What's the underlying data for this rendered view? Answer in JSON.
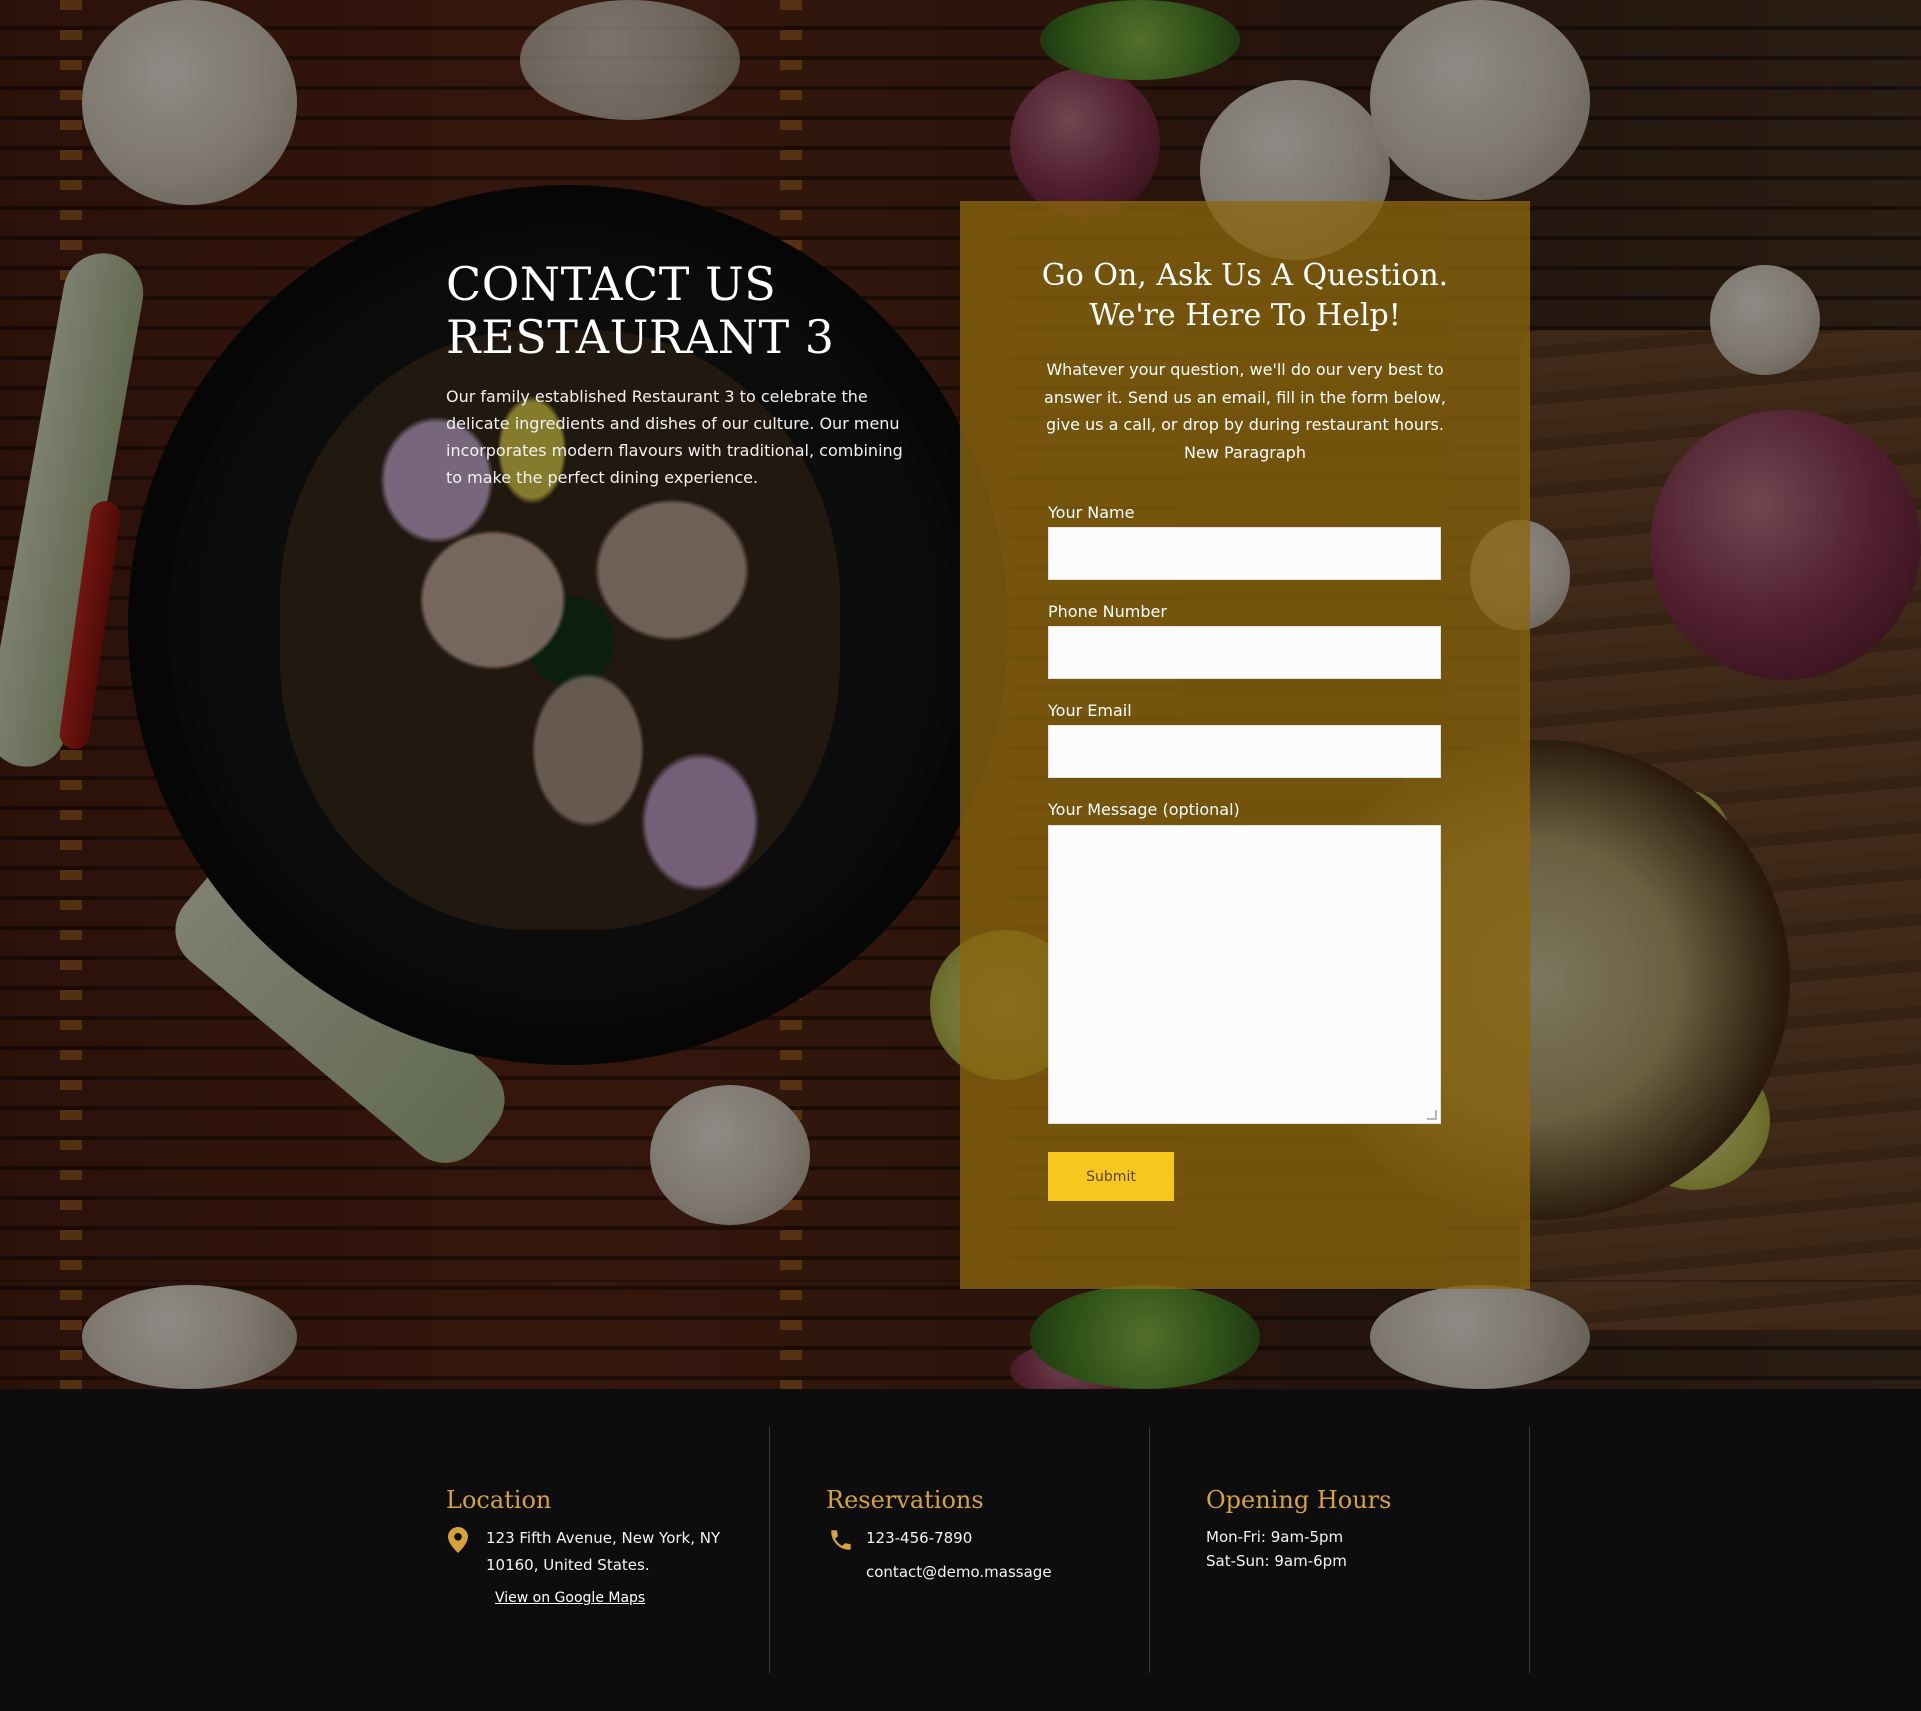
{
  "hero": {
    "title_line1": "CONTACT US",
    "title_line2": "RESTAURANT 3",
    "description": "Our family established Restaurant 3 to celebrate the delicate ingredients and dishes of our culture. Our menu incorporates modern flavours with traditional, combining to make the perfect dining experience."
  },
  "form": {
    "heading_line1": "Go On, Ask Us A Question.",
    "heading_line2": "We're Here To Help!",
    "lead": "Whatever your question, we'll do our very best to answer it. Send us an email, fill in the form below, give us a call, or drop by during restaurant hours. New Paragraph",
    "name_label": "Your Name",
    "name_value": "",
    "phone_label": "Phone Number",
    "phone_value": "",
    "email_label": "Your Email",
    "email_value": "",
    "message_label": "Your Message (optional)",
    "message_value": "",
    "submit_label": "Submit"
  },
  "footer": {
    "location": {
      "heading": "Location",
      "address_line1": "123 Fifth Avenue, New York, NY",
      "address_line2": "10160, United States.",
      "maps_link": "View on Google Maps",
      "icon": "map-pin-icon"
    },
    "reservations": {
      "heading": "Reservations",
      "phone": "123-456-7890",
      "email": "contact@demo.massage",
      "icon": "phone-icon"
    },
    "hours": {
      "heading": "Opening Hours",
      "weekday": "Mon-Fri: 9am-5pm",
      "weekend": "Sat-Sun: 9am-6pm"
    }
  },
  "colors": {
    "accent_gold": "#d6a23c",
    "button_yellow": "#f6c81e",
    "panel_overlay": "#8a660e",
    "footer_bg": "#0d0d0d"
  }
}
